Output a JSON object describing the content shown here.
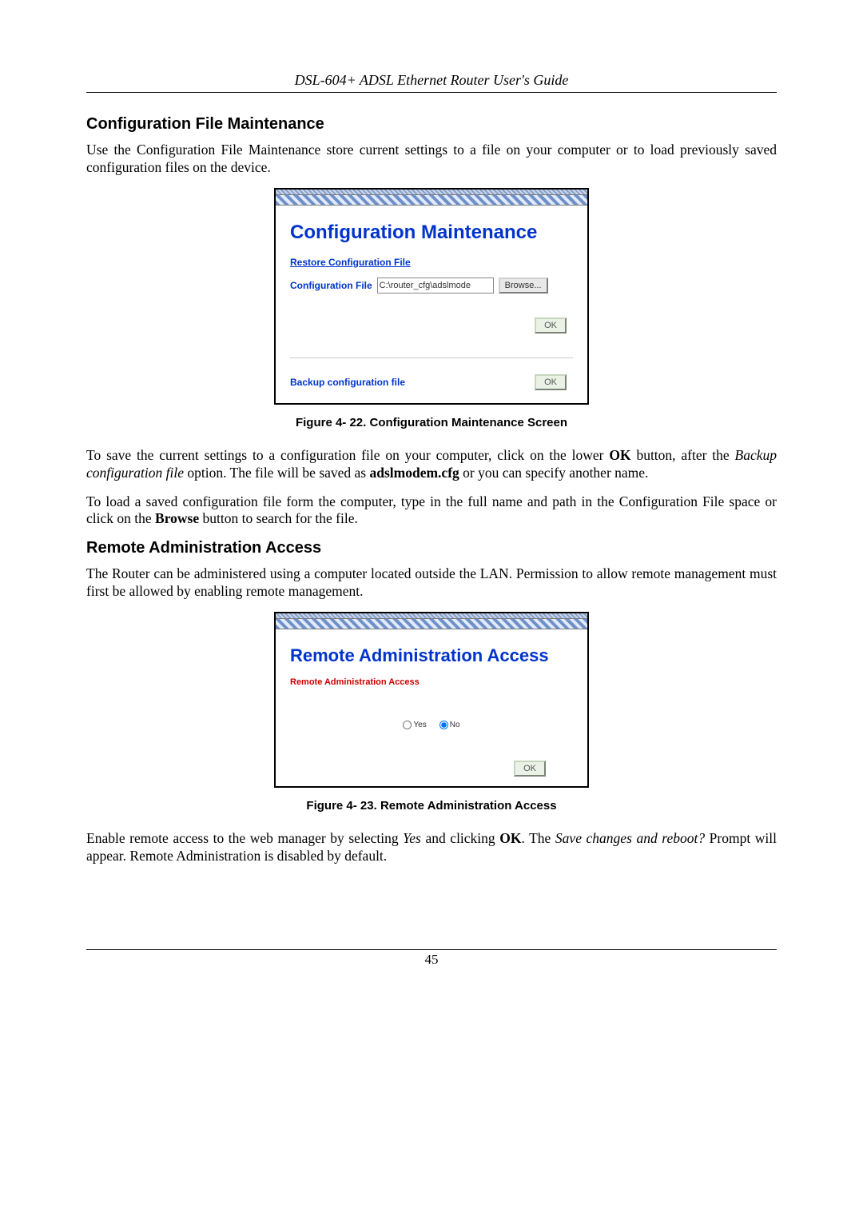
{
  "header": "DSL-604+ ADSL Ethernet Router User's Guide",
  "page_number": "45",
  "section1": {
    "title": "Configuration File Maintenance",
    "intro": "Use the Configuration File Maintenance store current settings to a file on your computer or to load previously saved configuration files on the device.",
    "caption": "Figure 4- 22. Configuration Maintenance Screen",
    "p2_a": "To save the current settings to a configuration file on your computer, click on the lower ",
    "p2_b": "OK",
    "p2_c": " button, after the ",
    "p2_d": "Backup configuration file",
    "p2_e": " option. The file will be saved as ",
    "p2_f": "adslmodem.cfg",
    "p2_g": " or you can specify another name.",
    "p3_a": "To load a saved configuration file form the computer, type in the full name and path in the Configuration File space or click on the ",
    "p3_b": "Browse",
    "p3_c": " button to search for the file."
  },
  "figure1": {
    "title": "Configuration Maintenance",
    "restore_link": "Restore Configuration File",
    "file_label": "Configuration File",
    "file_value": "C:\\router_cfg\\adslmode",
    "browse": "Browse...",
    "ok": "OK",
    "backup_label": "Backup configuration file"
  },
  "section2": {
    "title": "Remote Administration Access",
    "intro": "The Router can be administered using a computer located outside the LAN. Permission to allow remote management must first be allowed by enabling remote management.",
    "caption": "Figure 4- 23. Remote Administration Access",
    "p2_a": "Enable remote access to the web manager by selecting ",
    "p2_b": "Yes",
    "p2_c": " and clicking ",
    "p2_d": "OK",
    "p2_e": ". The ",
    "p2_f": "Save changes and reboot?",
    "p2_g": " Prompt will appear. Remote Administration is disabled by default."
  },
  "figure2": {
    "title": "Remote Administration Access",
    "section_label": "Remote Administration Access",
    "yes": "Yes",
    "no": "No",
    "ok": "OK"
  }
}
